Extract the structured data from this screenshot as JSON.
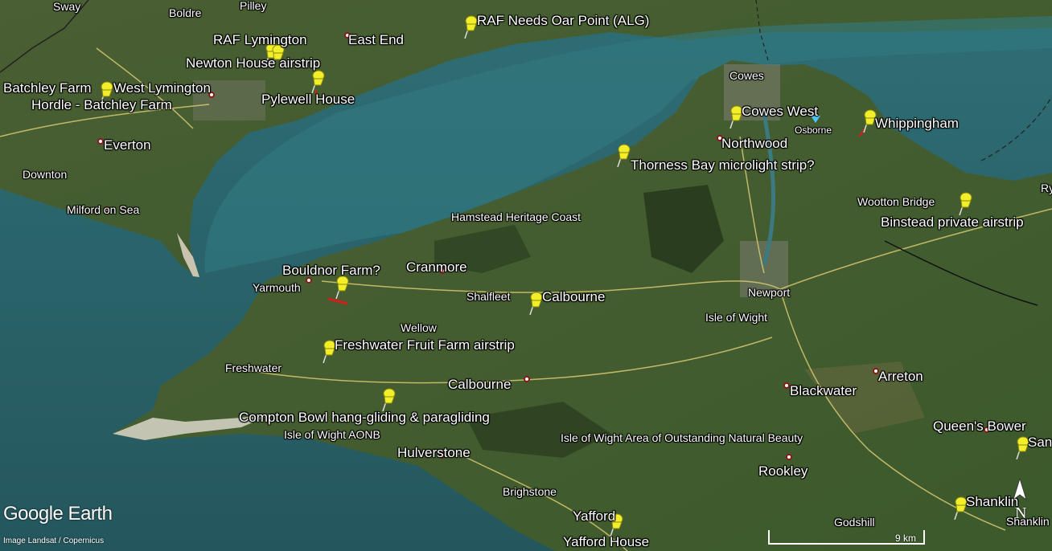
{
  "map": {
    "brand": "Google Earth",
    "credit": "Image Landsat / Copernicus",
    "scale_label": "9 km",
    "north_label": "N",
    "colors": {
      "sea": "#2e6a72",
      "land": "#3f5a2e",
      "pin": "#f2ee2a",
      "road": "#d9c870"
    },
    "places": [
      {
        "id": "sway",
        "text": "Sway"
      },
      {
        "id": "boldre",
        "text": "Boldre"
      },
      {
        "id": "pilley",
        "text": "Pilley"
      },
      {
        "id": "raf-needs-oar-point",
        "text": "RAF Needs Oar Point (ALG)"
      },
      {
        "id": "raf-lymington",
        "text": "RAF Lymington"
      },
      {
        "id": "east-end",
        "text": "East End"
      },
      {
        "id": "newton-house-airstrip",
        "text": "Newton House airstrip"
      },
      {
        "id": "batchley-farm",
        "text": "Batchley Farm"
      },
      {
        "id": "west-lymington",
        "text": "West Lymington"
      },
      {
        "id": "pylewell-house",
        "text": "Pylewell House"
      },
      {
        "id": "hordle-batchley-farm",
        "text": "Hordle - Batchley Farm"
      },
      {
        "id": "everton",
        "text": "Everton"
      },
      {
        "id": "downton",
        "text": "Downton"
      },
      {
        "id": "milford-on-sea",
        "text": "Milford on Sea"
      },
      {
        "id": "cowes",
        "text": "Cowes"
      },
      {
        "id": "cowes-west",
        "text": "Cowes West"
      },
      {
        "id": "osborne",
        "text": "Osborne"
      },
      {
        "id": "whippingham",
        "text": "Whippingham"
      },
      {
        "id": "northwood",
        "text": "Northwood"
      },
      {
        "id": "thorness-bay",
        "text": "Thorness Bay microlight strip?"
      },
      {
        "id": "wootton-bridge",
        "text": "Wootton Bridge"
      },
      {
        "id": "binstead-airstrip",
        "text": "Binstead private airstrip"
      },
      {
        "id": "ry",
        "text": "Ry"
      },
      {
        "id": "hamstead-heritage-coast",
        "text": "Hamstead Heritage Coast"
      },
      {
        "id": "bouldnor-farm",
        "text": "Bouldnor Farm?"
      },
      {
        "id": "cranmore",
        "text": "Cranmore"
      },
      {
        "id": "yarmouth",
        "text": "Yarmouth"
      },
      {
        "id": "shalfleet",
        "text": "Shalfleet"
      },
      {
        "id": "calbourne-pin",
        "text": "Calbourne"
      },
      {
        "id": "newport",
        "text": "Newport"
      },
      {
        "id": "isle-of-wight",
        "text": "Isle of Wight"
      },
      {
        "id": "wellow",
        "text": "Wellow"
      },
      {
        "id": "freshwater-fruit-farm",
        "text": "Freshwater Fruit Farm airstrip"
      },
      {
        "id": "freshwater",
        "text": "Freshwater"
      },
      {
        "id": "calbourne",
        "text": "Calbourne"
      },
      {
        "id": "arreton",
        "text": "Arreton"
      },
      {
        "id": "blackwater",
        "text": "Blackwater"
      },
      {
        "id": "compton-bowl",
        "text": "Compton Bowl hang-gliding &  paragliding"
      },
      {
        "id": "iow-aonb",
        "text": "Isle of Wight AONB"
      },
      {
        "id": "queens-bower",
        "text": "Queen's Bower"
      },
      {
        "id": "san",
        "text": "San"
      },
      {
        "id": "iow-area-natural-beauty",
        "text": "Isle of Wight Area of Outstanding Natural Beauty"
      },
      {
        "id": "hulverstone",
        "text": "Hulverstone"
      },
      {
        "id": "rookley",
        "text": "Rookley"
      },
      {
        "id": "brighstone",
        "text": "Brighstone"
      },
      {
        "id": "yafford",
        "text": "Yafford"
      },
      {
        "id": "yafford-house",
        "text": "Yafford House"
      },
      {
        "id": "shanklin-pin",
        "text": "Shanklin"
      },
      {
        "id": "godshill",
        "text": "Godshill"
      },
      {
        "id": "shanklin",
        "text": "Shanklin"
      }
    ]
  }
}
